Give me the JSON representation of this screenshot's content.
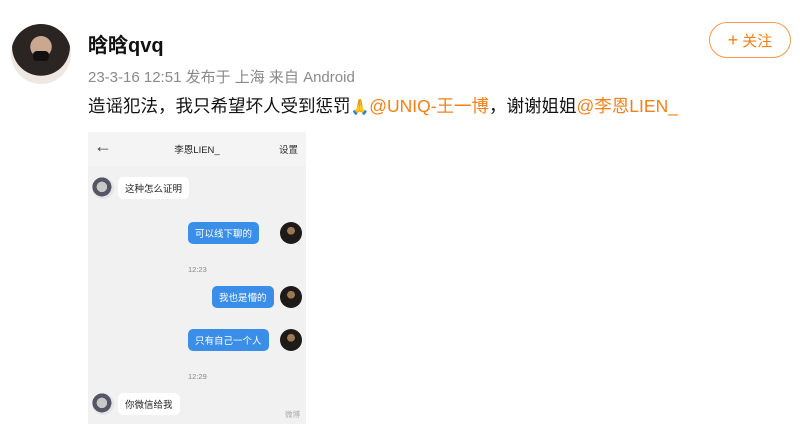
{
  "user": {
    "name": "晗晗qvq"
  },
  "meta": {
    "time": "23-3-16 12:51",
    "published": "发布于 上海",
    "source": "来自 Android"
  },
  "follow": {
    "icon": "plus-icon",
    "label": "关注"
  },
  "post": {
    "text1": "造谣犯法，我只希望坏人受到惩罚",
    "emoji": "🙏",
    "mention1": "@UNIQ-王一博",
    "text2": "，谢谢姐姐",
    "mention2": "@李恩LIEN_"
  },
  "screenshot": {
    "back_icon": "back-arrow-icon",
    "title": "李恩LIEN_",
    "settings": "设置",
    "messages": [
      {
        "side": "in",
        "text": "这种怎么证明"
      },
      {
        "side": "out",
        "text": "可以线下聊的"
      },
      {
        "side": "ts",
        "text": "12:23"
      },
      {
        "side": "out",
        "text": "我也是懵的"
      },
      {
        "side": "out",
        "text": "只有自己一个人"
      },
      {
        "side": "ts",
        "text": "12:29"
      },
      {
        "side": "in",
        "text": "你微信给我"
      }
    ],
    "watermark": "微博"
  }
}
